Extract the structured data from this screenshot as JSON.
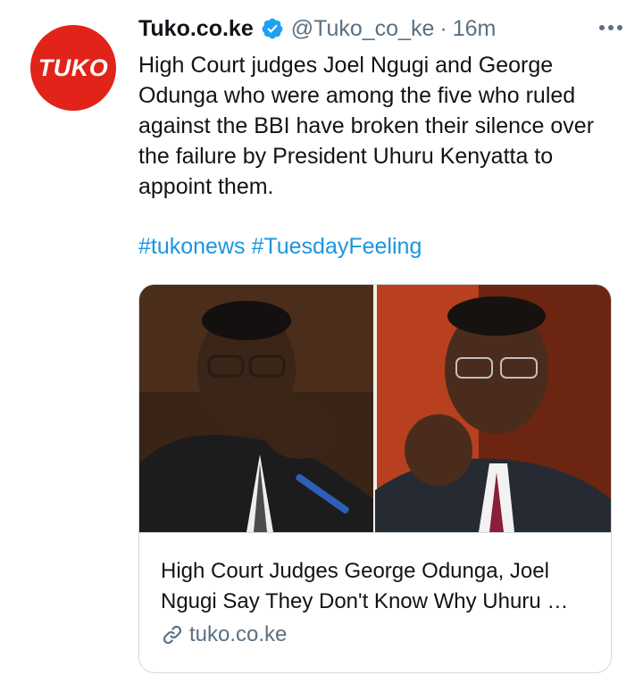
{
  "tweet": {
    "avatar_text": "TUKO",
    "author_name": "Tuko.co.ke",
    "author_handle": "@Tuko_co_ke",
    "separator": "·",
    "time": "16m",
    "text": "High Court judges Joel Ngugi and George Odunga who were among the five who ruled against the BBI have broken their silence over the failure by President Uhuru Kenyatta to appoint them.",
    "hashtags": [
      "#tukonews",
      "#TuesdayFeeling"
    ]
  },
  "card": {
    "title": "High Court Judges George Odunga, Joel Ngugi Say They Don't Know Why Uhuru …",
    "domain": "tuko.co.ke"
  },
  "colors": {
    "brand_red": "#e2231a",
    "link_blue": "#1b95e0",
    "verified_blue": "#1da1f2",
    "muted": "#5b7083"
  },
  "icons": {
    "verified": "verified-badge-icon",
    "more": "more-options-icon",
    "link": "link-icon"
  }
}
